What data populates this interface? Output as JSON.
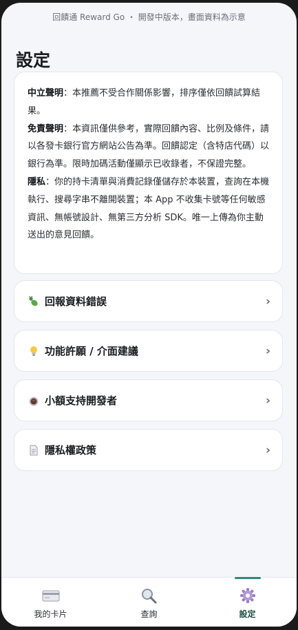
{
  "topbar": {
    "text": "回饋通 Reward Go ・ 開發中版本，畫面資料為示意"
  },
  "page": {
    "title": "設定"
  },
  "notice": {
    "neutral_heading": "中立聲明",
    "neutral_text": "：本推薦不受合作關係影響，排序僅依回饋試算結果。",
    "disclaimer_heading": "免責聲明",
    "disclaimer_text": "：本資訊僅供參考，實際回饋內容、比例及條件，請以各發卡銀行官方網站公告為準。回饋認定（含特店代碼）以銀行為準。限時加碼活動僅顯示已收錄者，不保證完整。",
    "privacy_heading": "隱私",
    "privacy_text": "：你的持卡清單與消費記錄僅儲存於本裝置，查詢在本機執行、搜尋字串不離開裝置；本 App 不收集卡號等任何敏感資訊、無帳號設計、無第三方分析 SDK。唯一上傳為你主動送出的意見回饋。"
  },
  "menu": [
    {
      "label": "回報資料錯誤",
      "icon": "bug-icon"
    },
    {
      "label": "功能許願 / 介面建議",
      "icon": "lightbulb-icon"
    },
    {
      "label": "小額支持開發者",
      "icon": "coffee-icon"
    },
    {
      "label": "隱私權政策",
      "icon": "document-icon"
    }
  ],
  "chevron": "›",
  "tabs": [
    {
      "label": "我的卡片",
      "icon": "credit-card-icon",
      "active": false
    },
    {
      "label": "查詢",
      "icon": "search-icon",
      "active": false
    },
    {
      "label": "設定",
      "icon": "gear-icon",
      "active": true
    }
  ],
  "colors": {
    "accent": "#2e8a7a",
    "background": "#f4f6fa",
    "card": "#ffffff"
  }
}
